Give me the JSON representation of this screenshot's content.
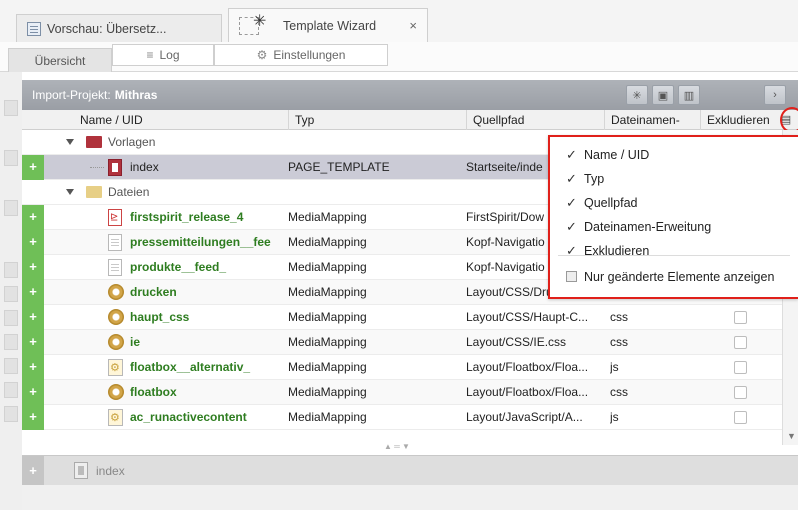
{
  "tabs": {
    "preview_label": "Vorschau: Übersetz...",
    "wizard_label": "Template Wizard",
    "close_glyph": "×"
  },
  "subtabs": {
    "overview": "Übersicht",
    "log": "Log",
    "settings": "Einstellungen"
  },
  "panel": {
    "title_prefix": "Import-Projekt:",
    "title_name": "Mithras"
  },
  "columns": {
    "name": "Name / UID",
    "type": "Typ",
    "source": "Quellpfad",
    "ext": "Dateinamen-",
    "exclude": "Exkludieren"
  },
  "rows": [
    {
      "kind": "folder",
      "name": "Vorlagen",
      "type": "",
      "source": "",
      "ext": ""
    },
    {
      "kind": "item",
      "name": "index",
      "type": "PAGE_TEMPLATE",
      "source": "Startseite/inde",
      "ext": ""
    },
    {
      "kind": "folder",
      "name": "Dateien",
      "type": "",
      "source": "",
      "ext": ""
    },
    {
      "kind": "item",
      "name": "firstspirit_release_4",
      "type": "MediaMapping",
      "source": "FirstSpirit/Dow",
      "ext": ""
    },
    {
      "kind": "item",
      "name": "pressemitteilungen__fee",
      "type": "MediaMapping",
      "source": "Kopf-Navigatio",
      "ext": ""
    },
    {
      "kind": "item",
      "name": "produkte__feed_",
      "type": "MediaMapping",
      "source": "Kopf-Navigatio",
      "ext": ""
    },
    {
      "kind": "item",
      "name": "drucken",
      "type": "MediaMapping",
      "source": "Layout/CSS/Drucken...",
      "ext": "css"
    },
    {
      "kind": "item",
      "name": "haupt_css",
      "type": "MediaMapping",
      "source": "Layout/CSS/Haupt-C...",
      "ext": "css"
    },
    {
      "kind": "item",
      "name": "ie",
      "type": "MediaMapping",
      "source": "Layout/CSS/IE.css",
      "ext": "css"
    },
    {
      "kind": "item",
      "name": "floatbox__alternativ_",
      "type": "MediaMapping",
      "source": "Layout/Floatbox/Floa...",
      "ext": "js"
    },
    {
      "kind": "item",
      "name": "floatbox",
      "type": "MediaMapping",
      "source": "Layout/Floatbox/Floa...",
      "ext": "css"
    },
    {
      "kind": "item",
      "name": "ac_runactivecontent",
      "type": "MediaMapping",
      "source": "Layout/JavaScript/A...",
      "ext": "js"
    }
  ],
  "selection": {
    "name": "index"
  },
  "menu": {
    "items": [
      {
        "label": "Name / UID",
        "checked": true
      },
      {
        "label": "Typ",
        "checked": true
      },
      {
        "label": "Quellpfad",
        "checked": true
      },
      {
        "label": "Dateinamen-Erweitung",
        "checked": true
      },
      {
        "label": "Exkludieren",
        "checked": true
      }
    ],
    "toggle_label": "Nur geänderte Elemente anzeigen",
    "check_glyph": "✓"
  },
  "colors": {
    "accent_green": "#6fbf57",
    "name_green": "#2e7d20",
    "highlight_red": "#e0201a",
    "selected_row": "#cbcbd6"
  },
  "icons": {
    "plus": "+"
  }
}
